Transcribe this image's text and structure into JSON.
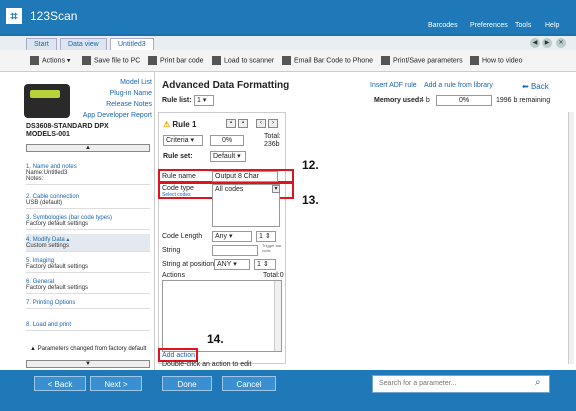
{
  "app": {
    "title": "123Scan"
  },
  "menus": [
    "Barcodes",
    "Preferences",
    "Tools",
    "Help"
  ],
  "tabs": [
    "Start",
    "Data view",
    "Untitled3"
  ],
  "toolbar": {
    "actions": "Actions",
    "save": "Save file to PC",
    "print": "Print bar code",
    "load": "Load to scanner",
    "email": "Email Bar Code to Phone",
    "printsave": "Print/Save parameters",
    "video": "How to video"
  },
  "left": {
    "links": [
      "Model List",
      "Plug-in Name",
      "Release Notes",
      "App Developer Report"
    ],
    "model": "DS3608-STANDARD DPX",
    "model2": "MODELS-001",
    "steps": [
      {
        "num": "1.",
        "title": "Name and notes",
        "detail1": "Name:Untitled3",
        "detail2": "Notes:"
      },
      {
        "num": "2.",
        "title": "Cable connection",
        "detail1": "USB (default)",
        "detail2": ""
      },
      {
        "num": "3.",
        "title": "Symbologies (bar code types)",
        "detail1": "Factory default settings",
        "detail2": ""
      },
      {
        "num": "4.",
        "title": "Modify Data",
        "detail1": "Custom settings",
        "detail2": ""
      },
      {
        "num": "5.",
        "title": "Imaging",
        "detail1": "Factory default settings",
        "detail2": ""
      },
      {
        "num": "6.",
        "title": "General",
        "detail1": "Factory default settings",
        "detail2": ""
      },
      {
        "num": "7.",
        "title": "Printing Options",
        "detail1": "",
        "detail2": ""
      },
      {
        "num": "8.",
        "title": "Load and print",
        "detail1": "",
        "detail2": ""
      }
    ],
    "note": "Parameters changed from factory default"
  },
  "main": {
    "title": "Advanced Data Formatting",
    "insert_adf": "Insert ADF rule",
    "add_rule": "Add a rule from library",
    "back": "Back",
    "rule_list_label": "Rule list:",
    "rule_list_value": "1",
    "memory_label": "Memory used:",
    "memory_value": "4 b",
    "memory_pct": "0%",
    "memory_remaining": "1996 b remaining",
    "rule_title": "Rule 1",
    "criteria": "Criteria",
    "criteria_pct": "0%",
    "total_label": "Total:",
    "total_value": "236b",
    "rule_set_label": "Rule set:",
    "rule_set_value": "Default",
    "rule_name_label": "Rule name",
    "rule_name_value": "Output 8 Char",
    "code_type_label": "Code type",
    "select_codes": "Select codes",
    "code_type_value": "All codes",
    "code_length_label": "Code Length",
    "code_length_value": "Any",
    "code_length_num": "1",
    "string_label": "String",
    "trigger_note": "Trigger bar code",
    "string_pos_label": "String at position",
    "string_pos_value": "ANY",
    "string_pos_num": "1",
    "actions_label": "Actions",
    "actions_total": "Total:0",
    "add_action": "Add action",
    "double_click": "Double-click an action to edit"
  },
  "callouts": [
    "12.",
    "13.",
    "14."
  ],
  "bottom": {
    "back": "< Back",
    "next": "Next >",
    "done": "Done",
    "cancel": "Cancel",
    "search_placeholder": "Search for a parameter..."
  }
}
